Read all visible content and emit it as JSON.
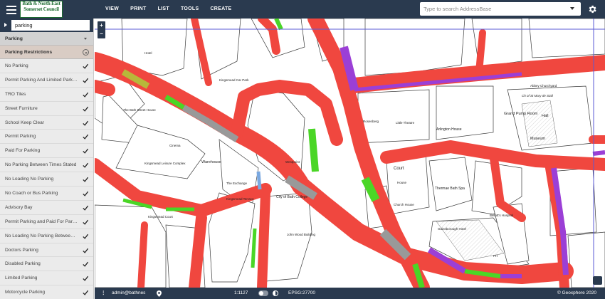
{
  "header": {
    "logo_lines": [
      "Bath & North East",
      "Somerset Council"
    ],
    "menu": [
      "VIEW",
      "PRINT",
      "LIST",
      "TOOLS",
      "CREATE"
    ],
    "search_placeholder": "Type to search AddressBase"
  },
  "sidebar": {
    "filter_value": "parking",
    "group_label": "Parking",
    "subgroup_label": "Parking Restrictions",
    "layers": [
      "No Parking",
      "Permit Parking And Limited Parking",
      "TRO Tiles",
      "Street Furniture",
      "School Keep Clear",
      "Permit Parking",
      "Paid For Parking",
      "No Parking Between Times Stated",
      "No Loading No Parking",
      "No Coach or Bus Parking",
      "Advisory Bay",
      "Permit Parking and Paid For Parking",
      "No Loading No Parking Between Times Stated",
      "Doctors Parking",
      "Disabled Parking",
      "Limited Parking",
      "Motorcycle Parking"
    ]
  },
  "map": {
    "zoom_in": "+",
    "zoom_out": "−",
    "labels": {
      "hotel": "Hotel",
      "car_park": "Kingsmead Car Park",
      "bath_street": "The Bath Street House",
      "cinema": "Cinema",
      "leisure": "Kingsmead Leisure Complex",
      "warehouse": "Warehouse",
      "westpoint": "Westpoint",
      "exchange": "The Exchange",
      "terrace": "Kingsmead Terrace",
      "college": "City of Bath College",
      "john_wood": "John Wood Building",
      "kingsmead_court": "Kingsmead Court",
      "rosenberg": "Rosenberg",
      "little_theatre": "Little Theatre",
      "arlington": "Arlington House",
      "court": "Court",
      "church_house": "Church House",
      "thermae": "Thermae Bath Spa",
      "beliott": "Bellott's Hospital",
      "gainsborough": "Gainsborough Hotel",
      "grand_pump": "Grand Pump Room",
      "hall": "Hall",
      "museum": "Museum",
      "churchyard": "Abbey Churchyard",
      "st_mary": "Ch of St Mary de Stall",
      "ph": "PH",
      "house": "House"
    }
  },
  "status": {
    "user": "admin@bathnes",
    "scale": "1:1127",
    "epsg": "EPSG:27700",
    "copyright": "© Geoxphere 2020"
  },
  "colors": {
    "topbar": "#2a3a4f",
    "road_restriction": "#f0473f",
    "bay_green": "#4ad626",
    "bay_purple": "#9b3fd6",
    "bay_grey": "#999999",
    "bay_olive": "#b8b83a"
  }
}
